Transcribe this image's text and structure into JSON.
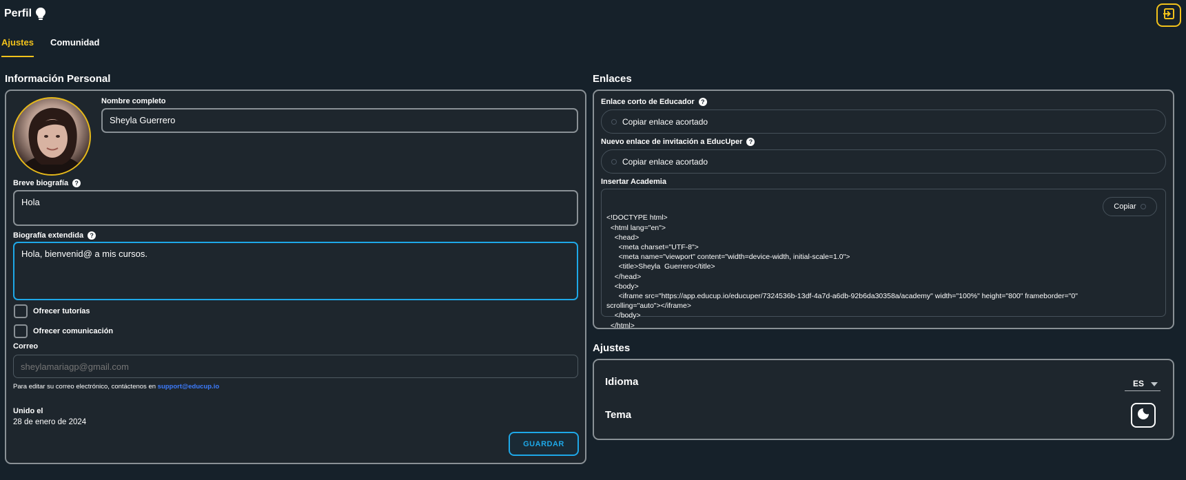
{
  "header": {
    "title": "Perfil",
    "bulb_icon": "lightbulb-icon",
    "logout_icon": "logout-icon",
    "accent_color": "#f2c21b"
  },
  "tabs": [
    {
      "label": "Ajustes",
      "active": true
    },
    {
      "label": "Comunidad",
      "active": false
    }
  ],
  "personal": {
    "section_title": "Información Personal",
    "fullname_label": "Nombre completo",
    "fullname_value": "Sheyla  Guerrero",
    "short_bio_label": "Breve biografía",
    "short_bio_value": "Hola",
    "long_bio_label": "Biografía extendida",
    "long_bio_value": "Hola, bienvenid@ a mis cursos.",
    "offer_tutoring_label": "Ofrecer tutorías",
    "offer_communication_label": "Ofrecer comunicación",
    "email_label": "Correo",
    "email_placeholder": "sheylamariagp@gmail.com",
    "email_note": "Para editar su correo electrónico, contáctenos en ",
    "support_email": "support@educup.io",
    "joined_label": "Unido el",
    "joined_value": "28 de enero de 2024",
    "save_label": "GUARDAR"
  },
  "links": {
    "section_title": "Enlaces",
    "educator_link_label": "Enlace corto de Educador",
    "educator_copy_label": "Copiar enlace acortado",
    "invite_link_label": "Nuevo enlace de invitación a EducUper",
    "invite_copy_label": "Copiar enlace acortado",
    "embed_label": "Insertar Academia",
    "embed_code": "<!DOCTYPE html>\n  <html lang=\"en\">\n    <head>\n      <meta charset=\"UTF-8\">\n      <meta name=\"viewport\" content=\"width=device-width, initial-scale=1.0\">\n      <title>Sheyla  Guerrero</title>\n    </head>\n    <body>\n      <iframe src=\"https://app.educup.io/educuper/7324536b-13df-4a7d-a6db-92b6da30358a/academy\" width=\"100%\" height=\"800\" frameborder=\"0\" scrolling=\"auto\"></iframe>\n    </body>\n  </html>",
    "copy_button_label": "Copiar"
  },
  "settings": {
    "section_title": "Ajustes",
    "language_label": "Idioma",
    "language_value": "ES",
    "theme_label": "Tema",
    "theme_icon": "moon-icon"
  }
}
